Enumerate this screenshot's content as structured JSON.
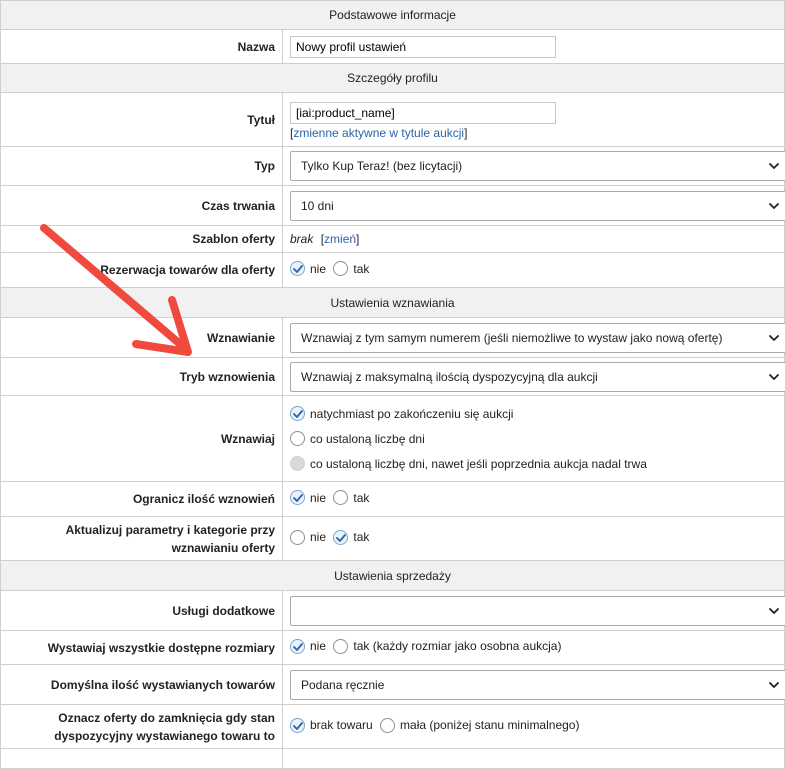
{
  "sections": {
    "basic": "Podstawowe informacje",
    "profile": "Szczegóły profilu",
    "renewal": "Ustawienia wznawiania",
    "sales": "Ustawienia sprzedaży"
  },
  "name": {
    "label": "Nazwa",
    "value": "Nowy profil ustawień"
  },
  "title": {
    "label": "Tytuł",
    "value": "[iai:product_name]",
    "link_open": "[",
    "link": "zmienne aktywne w tytule aukcji",
    "link_close": "]"
  },
  "type": {
    "label": "Typ",
    "value": "Tylko Kup Teraz! (bez licytacji)"
  },
  "duration": {
    "label": "Czas trwania",
    "value": "10 dni"
  },
  "template": {
    "label": "Szablon oferty",
    "value": "brak",
    "link_open": "[",
    "link": "zmień",
    "link_close": "]"
  },
  "reservation": {
    "label": "Rezerwacja towarów dla oferty",
    "options": [
      "nie",
      "tak"
    ],
    "selected": "nie"
  },
  "renew": {
    "label": "Wznawianie",
    "value": "Wznawiaj z tym samym numerem (jeśli niemożliwe to wystaw jako nową ofertę)"
  },
  "renew_mode": {
    "label": "Tryb wznowienia",
    "value": "Wznawiaj z maksymalną ilością dyspozycyjną dla aukcji"
  },
  "renew_when": {
    "label": "Wznawiaj",
    "options": [
      "natychmiast po zakończeniu się aukcji",
      "co ustaloną liczbę dni",
      "co ustaloną liczbę dni, nawet jeśli poprzednia aukcja nadal trwa"
    ],
    "selected": "natychmiast po zakończeniu się aukcji"
  },
  "limit": {
    "label": "Ogranicz ilość wznowień",
    "options": [
      "nie",
      "tak"
    ],
    "selected": "nie"
  },
  "update_params": {
    "label": "Aktualizuj parametry i kategorie przy wznawianiu oferty",
    "options": [
      "nie",
      "tak"
    ],
    "selected": "tak"
  },
  "services": {
    "label": "Usługi dodatkowe",
    "value": ""
  },
  "all_sizes": {
    "label": "Wystawiaj wszystkie dostępne rozmiary",
    "options": [
      "nie",
      "tak (każdy rozmiar jako osobna aukcja)"
    ],
    "selected": "nie"
  },
  "default_qty": {
    "label": "Domyślna ilość wystawianych towarów",
    "value": "Podana ręcznie"
  },
  "mark_close": {
    "label": "Oznacz oferty do zamknięcia gdy stan dyspozycyjny wystawianego towaru to",
    "options": [
      "brak towaru",
      "mała (poniżej stanu minimalnego)"
    ],
    "selected": "brak towaru"
  },
  "colors": {
    "arrow": "#f04a3e",
    "link": "#2a64a8",
    "section_bg": "#f1f1f1",
    "border": "#cfcfcf"
  }
}
